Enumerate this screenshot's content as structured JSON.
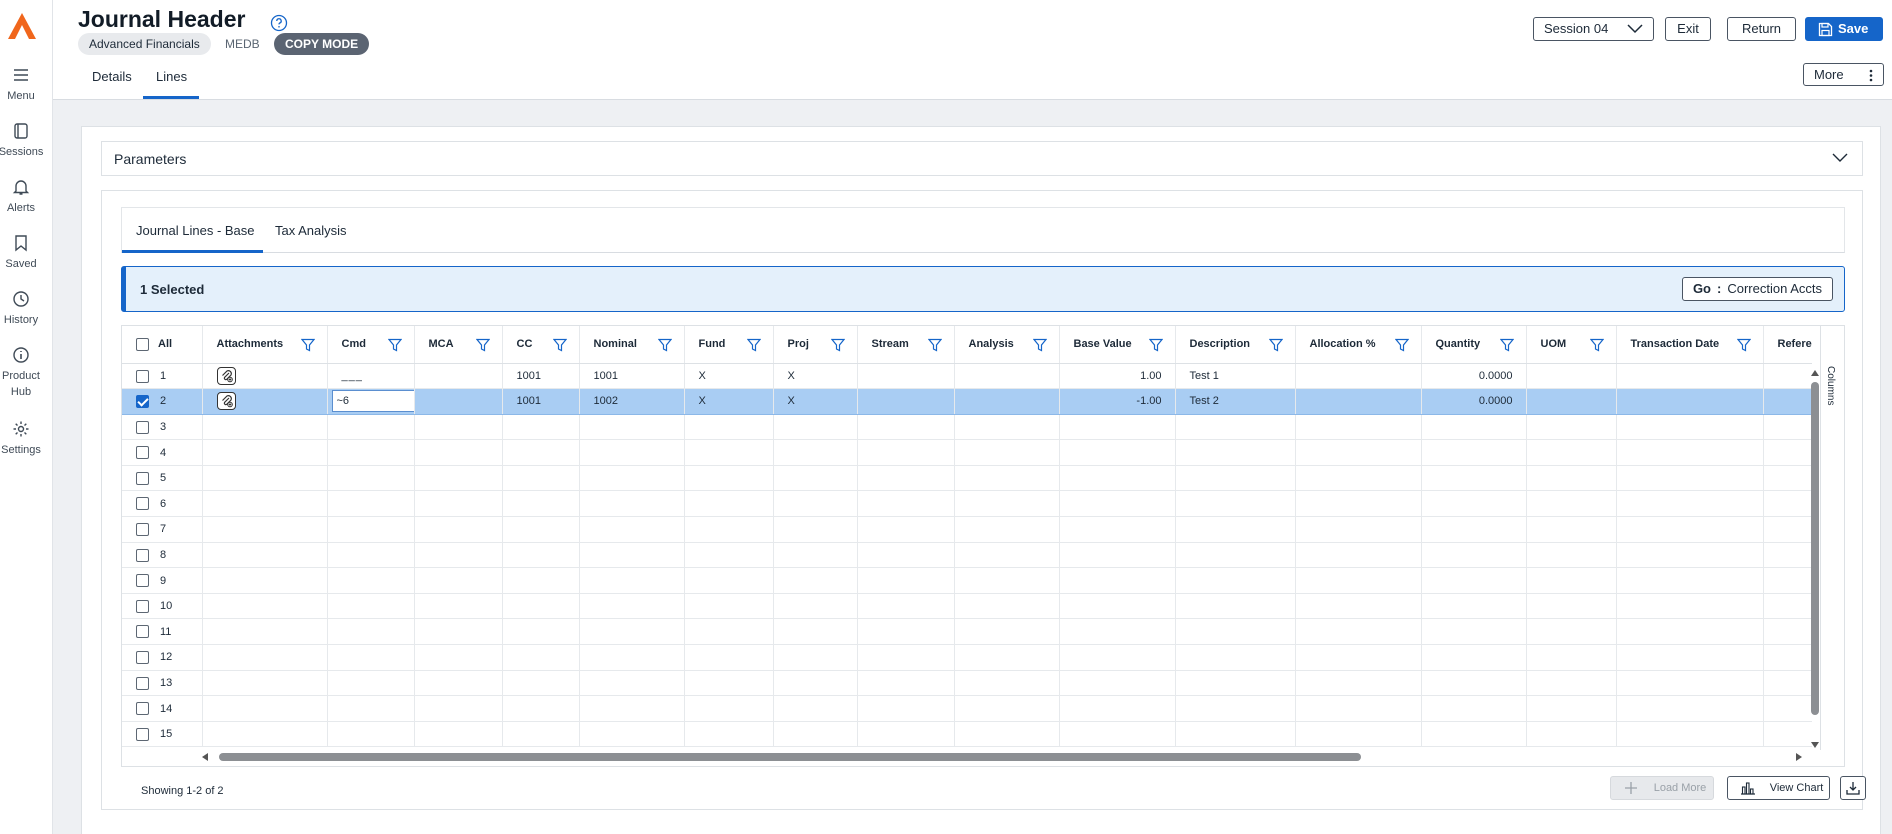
{
  "rail": {
    "items": [
      {
        "label": "Menu",
        "icon": "menu-icon"
      },
      {
        "label": "Sessions",
        "icon": "sessions-icon"
      },
      {
        "label": "Alerts",
        "icon": "bell-icon"
      },
      {
        "label": "Saved",
        "icon": "bookmark-icon"
      },
      {
        "label": "History",
        "icon": "clock-icon"
      },
      {
        "label": "Product Hub",
        "icon": "info-icon"
      },
      {
        "label": "Settings",
        "icon": "gear-icon"
      }
    ],
    "logo_color": "#f0661c"
  },
  "header": {
    "title": "Journal Header",
    "chips": {
      "module": "Advanced Financials",
      "db": "MEDB",
      "mode": "COPY MODE"
    },
    "session": "Session 04",
    "exit": "Exit",
    "return": "Return",
    "save": "Save",
    "more": "More",
    "tabs": [
      "Details",
      "Lines"
    ],
    "active_tab": "Lines"
  },
  "parameters": {
    "title": "Parameters"
  },
  "subtabs": {
    "items": [
      "Journal Lines - Base",
      "Tax Analysis"
    ],
    "active": "Journal Lines - Base"
  },
  "selection": {
    "text": "1 Selected",
    "go_label": "Go",
    "go_sep": ":",
    "go_value": "Correction Accts"
  },
  "grid": {
    "all_label": "All",
    "columns": [
      "Attachments",
      "Cmd",
      "MCA",
      "CC",
      "Nominal",
      "Fund",
      "Proj",
      "Stream",
      "Analysis",
      "Base Value",
      "Description",
      "Allocation %",
      "Quantity",
      "UOM",
      "Transaction Date",
      "Referenc"
    ],
    "rows": [
      {
        "idx": "1",
        "checked": false,
        "attach": true,
        "cmd": "___",
        "mca": "",
        "cc": "1001",
        "nominal": "1001",
        "fund": "X",
        "proj": "X",
        "stream": "",
        "analysis": "",
        "base": "1.00",
        "desc": "Test 1",
        "alloc": "",
        "qty": "0.0000",
        "uom": "",
        "tdate": "",
        "ref": ""
      },
      {
        "idx": "2",
        "checked": true,
        "attach": true,
        "cmd": "~6",
        "mca": "",
        "cc": "1001",
        "nominal": "1002",
        "fund": "X",
        "proj": "X",
        "stream": "",
        "analysis": "",
        "base": "-1.00",
        "desc": "Test 2",
        "alloc": "",
        "qty": "0.0000",
        "uom": "",
        "tdate": "",
        "ref": ""
      }
    ],
    "empty_rows": [
      "3",
      "4",
      "5",
      "6",
      "7",
      "8",
      "9",
      "10",
      "11",
      "12",
      "13",
      "14",
      "15"
    ],
    "columns_tab": "Columns"
  },
  "footer": {
    "showing": "Showing 1-2 of 2",
    "load_more": "Load More",
    "view_chart": "View Chart"
  },
  "colors": {
    "accent": "#1565c9",
    "selected_row": "#a9cdf3",
    "chip_dark": "#5b6472"
  }
}
